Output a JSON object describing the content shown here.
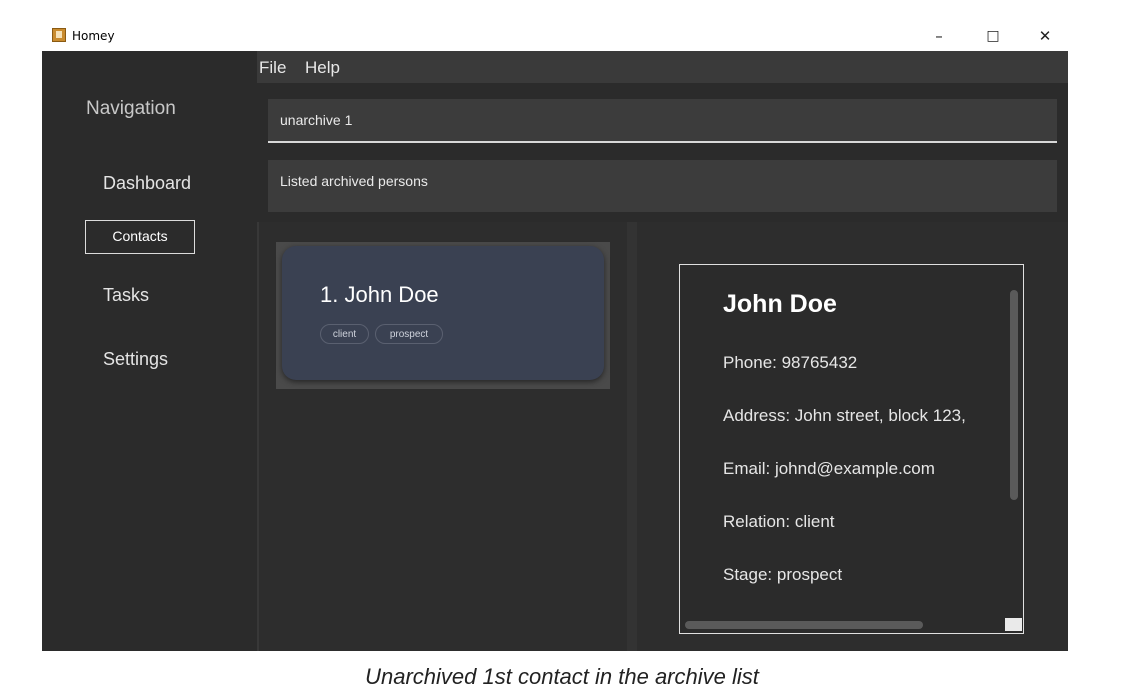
{
  "window": {
    "title": "Homey",
    "minimize": "–",
    "maximize": "□",
    "close": "✕"
  },
  "menu": {
    "file": "File",
    "help": "Help"
  },
  "sidebar": {
    "title": "Navigation",
    "items": [
      {
        "label": "Dashboard",
        "active": false
      },
      {
        "label": "Contacts",
        "active": true
      },
      {
        "label": "Tasks",
        "active": false
      },
      {
        "label": "Settings",
        "active": false
      }
    ]
  },
  "command_box": {
    "value": "unarchive 1"
  },
  "result_display": {
    "text": "Listed archived persons"
  },
  "contact_list": [
    {
      "index": "1.",
      "name": "John Doe",
      "tags": [
        "client",
        "prospect"
      ]
    }
  ],
  "detail": {
    "name": "John Doe",
    "phone": "Phone: 98765432",
    "address": "Address: John street, block 123,",
    "email": "Email: johnd@example.com",
    "relation": "Relation: client",
    "stage": "Stage: prospect"
  },
  "caption": "Unarchived 1st contact in the archive list",
  "colors": {
    "background": "#2b2b2b",
    "card": "#3a4152",
    "text": "#e6e6e6"
  }
}
